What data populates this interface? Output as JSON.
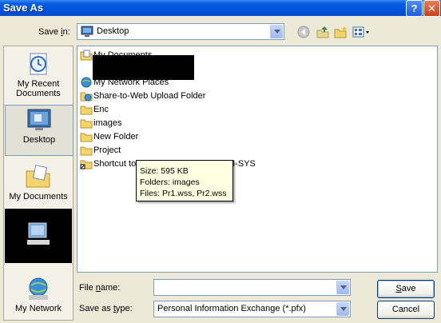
{
  "window": {
    "title": "Save As",
    "help": "?",
    "close": "✕"
  },
  "save_in": {
    "label_pre": "Save ",
    "label_ul": "i",
    "label_post": "n:",
    "value": "Desktop"
  },
  "places": [
    {
      "label": "My Recent Documents"
    },
    {
      "label": "Desktop"
    },
    {
      "label": "My Documents"
    },
    {
      "label": "My Computer"
    },
    {
      "label": "My Network"
    }
  ],
  "files": [
    {
      "name": "My Documents"
    },
    {
      "name": "My Network Places"
    },
    {
      "name": "Share-to-Web Upload Folder"
    },
    {
      "name": "Enc"
    },
    {
      "name": "images"
    },
    {
      "name": "New Folder"
    },
    {
      "name": "Project"
    },
    {
      "name": "Shortcut to",
      "suffix": "M-SYS"
    }
  ],
  "tooltip": {
    "size": "Size: 595 KB",
    "folders": "Folders: images",
    "files": "Files: Pr1.wss, Pr2.wss"
  },
  "file_name": {
    "label_pre": "File ",
    "label_ul": "n",
    "label_post": "ame:",
    "value": ""
  },
  "save_type": {
    "label_pre": "Save as ",
    "label_ul": "t",
    "label_post": "ype:",
    "value": "Personal Information Exchange (*.pfx)"
  },
  "buttons": {
    "save_ul": "S",
    "save_rest": "ave",
    "cancel": "Cancel"
  },
  "colors": {
    "titlebar": "#0054E3",
    "dialog_bg": "#ECE9D8",
    "folder": "#F5D56B"
  }
}
